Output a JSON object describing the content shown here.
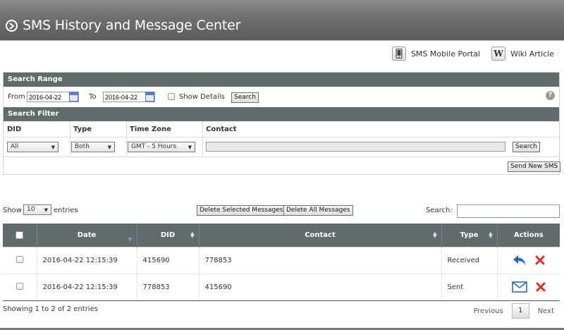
{
  "header": {
    "title": "SMS History and Message Center"
  },
  "toplinks": {
    "portal": "SMS Mobile Portal",
    "wiki": "Wiki Article",
    "wiki_glyph": "W"
  },
  "search_range": {
    "bar_title": "Search Range",
    "from_label": "From",
    "from_value": "2016-04-22",
    "to_label": "To",
    "to_value": "2016-04-22",
    "show_details_label": "Show Details",
    "search_button": "Search",
    "help_glyph": "?"
  },
  "search_filter": {
    "bar_title": "Search Filter",
    "headers": {
      "did": "DID",
      "type": "Type",
      "timezone": "Time Zone",
      "contact": "Contact"
    },
    "did_value": "All",
    "type_value": "Both",
    "timezone_value": "GMT - 5 Hours",
    "search_button": "Search",
    "send_new_button": "Send New SMS"
  },
  "controls": {
    "show_label": "Show",
    "page_size": "10",
    "entries_label": "entries",
    "delete_selected": "Delete Selected Messages",
    "delete_all": "Delete All Messages",
    "search_label": "Search:"
  },
  "table": {
    "columns": {
      "date": "Date",
      "did": "DID",
      "contact": "Contact",
      "type": "Type",
      "actions": "Actions"
    },
    "rows": [
      {
        "date": "2016-04-22 12:15:39",
        "did": "415690",
        "contact": "778853",
        "type": "Received",
        "action_icon": "reply-icon"
      },
      {
        "date": "2016-04-22 12:15:39",
        "did": "778853",
        "contact": "415690",
        "type": "Sent",
        "action_icon": "envelope-icon"
      }
    ]
  },
  "footer": {
    "info": "Showing 1 to 2 of 2 entries",
    "previous": "Previous",
    "page": "1",
    "next": "Next"
  },
  "colors": {
    "header_bar": "#626b6b",
    "reply_blue": "#2a6ab5",
    "delete_red": "#d9322c"
  }
}
